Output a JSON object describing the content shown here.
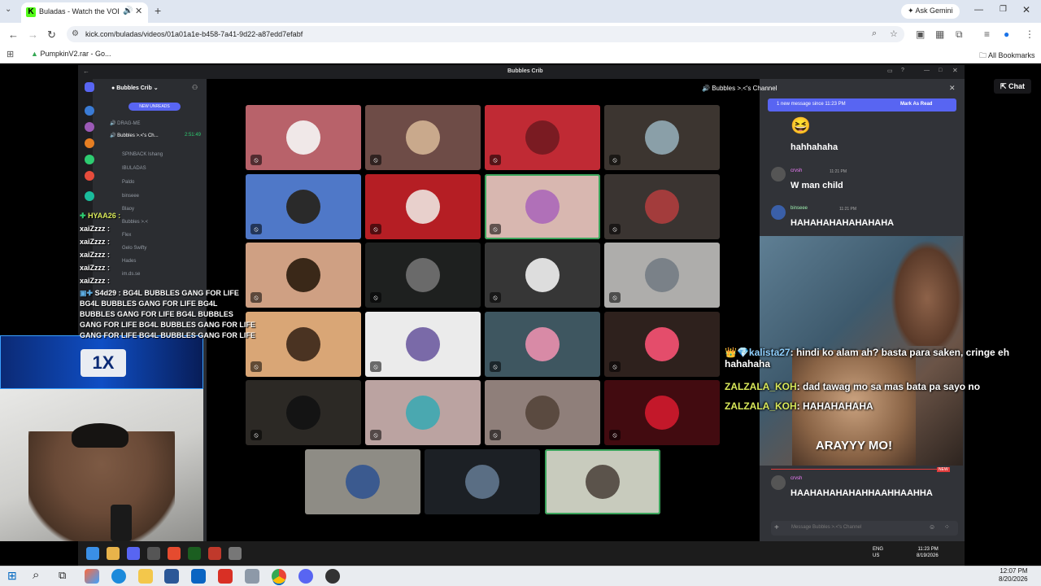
{
  "browser": {
    "tab_title": "Buladas - Watch the VOD o",
    "tab_favicon": "K",
    "url": "kick.com/buladas/videos/01a01a1e-b458-7a41-9d22-a87edd7efabf",
    "gemini_label": "Ask Gemini",
    "bookmark_item": "PumpkinV2.rar - Go...",
    "all_bookmarks": "All Bookmarks",
    "kick_chat_label": "Chat"
  },
  "discord": {
    "window_title": "Bubbles Crib",
    "server_name": "Bubbles Crib",
    "new_unreads": "NEW UNREADS",
    "channels": [
      "DRAG-ME",
      "Bubbles >.<'s Ch...",
      "SPINBACK Ishang",
      "IBULADAS",
      "Paldo",
      "binseee",
      "Blaoy",
      "Bubbles >.<",
      "Flex",
      "Gelo Swifty",
      "Hades",
      "im.ds.se"
    ],
    "channel_timer": "2:51:49",
    "chat_header": "Bubbles >.<'s Channel",
    "new_message_banner": "1 new message since 11:23 PM",
    "mark_as_read": "Mark As Read",
    "messages": [
      {
        "user": "",
        "time": "",
        "text": "hahhahaha"
      },
      {
        "user": "crvsh",
        "time": "11:21 PM",
        "text": "W man child"
      },
      {
        "user": "binseee",
        "time": "11:21 PM",
        "text": "HAHAHAHAHAHAHAHA"
      },
      {
        "user": "crvsh",
        "time": "",
        "text": "HAAHAHAHAHAHHAAHHAAHHA"
      }
    ],
    "message_placeholder": "Message Bubbles >.<'s Channel"
  },
  "tiles": [
    {
      "bg": "#b8626a",
      "av": "#f0e8e8"
    },
    {
      "bg": "#6e4c47",
      "av": "#c9a98c"
    },
    {
      "bg": "#c02a34",
      "av": "#7a1b22"
    },
    {
      "bg": "#3c3530",
      "av": "#8a9fa8"
    },
    {
      "bg": "#4f78c8",
      "av": "#2a2a2a"
    },
    {
      "bg": "#b51e24",
      "av": "#e8d0cc"
    },
    {
      "bg": "#d8b7b0",
      "av": "#b070b8"
    },
    {
      "bg": "#3a3431",
      "av": "#a33c3c"
    },
    {
      "bg": "#cfa083",
      "av": "#3a2818"
    },
    {
      "bg": "#1e201f",
      "av": "#6a6a6a"
    },
    {
      "bg": "#363636",
      "av": "#ddd"
    },
    {
      "bg": "#aeadab",
      "av": "#7a8188"
    },
    {
      "bg": "#d9a676",
      "av": "#4a3322"
    },
    {
      "bg": "#ebebeb",
      "av": "#7a6aa8"
    },
    {
      "bg": "#3e5660",
      "av": "#d88aa6"
    },
    {
      "bg": "#2e211d",
      "av": "#e44d6b"
    },
    {
      "bg": "#2c2925",
      "av": "#141414"
    },
    {
      "bg": "#bba3a1",
      "av": "#4aa8b0"
    },
    {
      "bg": "#8f7f7a",
      "av": "#5a4a40"
    },
    {
      "bg": "#420b10",
      "av": "#c3182a"
    },
    {
      "bg": "#8e8c85",
      "av": "#3b5a8f"
    },
    {
      "bg": "#1c2025",
      "av": "#5a6e84"
    },
    {
      "bg": "#c8cbbd",
      "av": "#5b534b"
    }
  ],
  "left_chat": [
    "HYAA26 :",
    "xaiZzzz :",
    "xaiZzzz :",
    "xaiZzzz :",
    "xaiZzzz :",
    "xaiZzzz :",
    "S4d29 : BG4L BUBBLES GANG FOR LIFE",
    "BG4L BUBBLES GANG FOR LIFE   BG4L",
    "BUBBLES GANG FOR LIFE   BG4L BUBBLES",
    "GANG FOR LIFE   BG4L BUBBLES GANG FOR LIFE",
    "GANG FOR LIFE   BG4L BUBBLES GANG FOR LIFE"
  ],
  "right_chat": [
    {
      "user": "kalista27",
      "text": ": hindi ko alam ah? basta para saken, cringe eh hahahaha"
    },
    {
      "user": "ZALZALA_KOH",
      "text": ": dad tawag mo sa mas bata pa sayo no"
    },
    {
      "user": "ZALZALA_KOH",
      "text": ": HAHAHAHAHA"
    }
  ],
  "overlay": {
    "meme_caption": "ARAYYY MO!",
    "sponsor_logo": "1X"
  },
  "inner_taskbar": {
    "lang": "ENG",
    "region": "US",
    "time": "11:23 PM",
    "date": "8/19/2026"
  },
  "taskbar": {
    "time": "12:07 PM",
    "date": "8/20/2026"
  }
}
